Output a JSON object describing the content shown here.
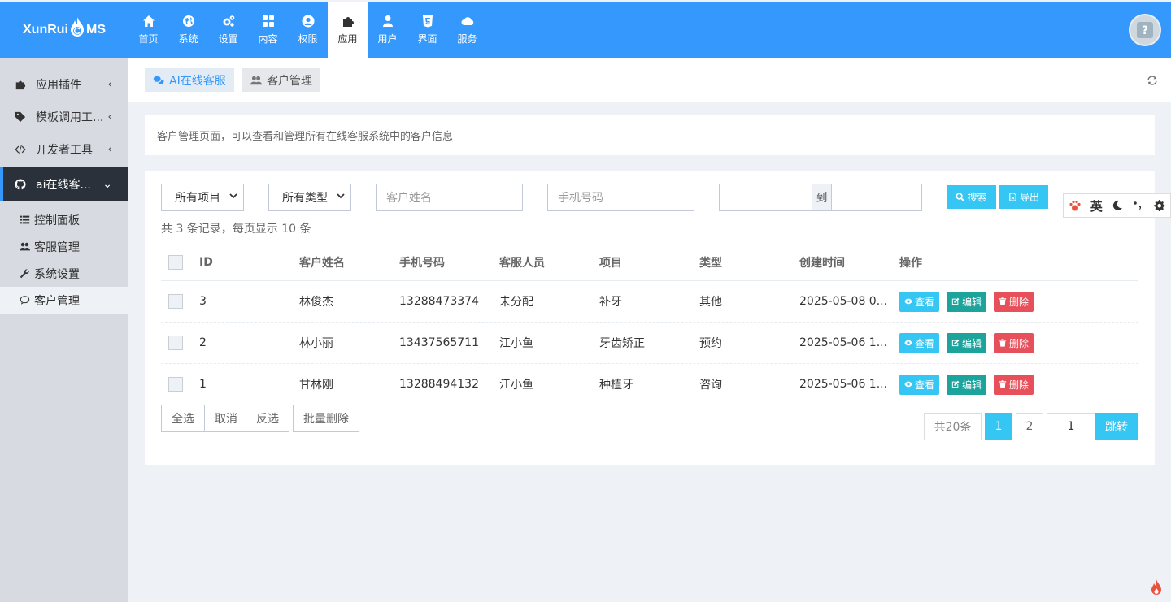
{
  "brand": {
    "left": "XunRui",
    "right": "MS"
  },
  "nav": [
    {
      "label": "首页",
      "icon": "home-icon"
    },
    {
      "label": "系统",
      "icon": "globe-icon"
    },
    {
      "label": "设置",
      "icon": "gears-icon"
    },
    {
      "label": "内容",
      "icon": "grid-icon"
    },
    {
      "label": "权限",
      "icon": "user-circle-icon"
    },
    {
      "label": "应用",
      "icon": "puzzle-icon",
      "active": true
    },
    {
      "label": "用户",
      "icon": "user-icon"
    },
    {
      "label": "界面",
      "icon": "html5-icon"
    },
    {
      "label": "服务",
      "icon": "cloud-icon"
    }
  ],
  "sidebar": {
    "groups": [
      {
        "label": "应用插件",
        "icon": "puzzle-icon"
      },
      {
        "label": "模板调用工...",
        "icon": "tag-icon"
      },
      {
        "label": "开发者工具",
        "icon": "code-icon"
      },
      {
        "label": "ai在线客...",
        "icon": "github-icon",
        "open": true
      }
    ],
    "items": [
      {
        "label": "控制面板",
        "icon": "list-icon"
      },
      {
        "label": "客服管理",
        "icon": "users-icon"
      },
      {
        "label": "系统设置",
        "icon": "wrench-icon"
      },
      {
        "label": "客户管理",
        "icon": "comment-icon",
        "active": true
      }
    ]
  },
  "tabs": [
    {
      "label": "AI在线客服",
      "icon": "comments-icon",
      "active": true
    },
    {
      "label": "客户管理",
      "icon": "users-icon"
    }
  ],
  "note": "客户管理页面，可以查看和管理所有在线客服系统中的客户信息",
  "filters": {
    "project": "所有项目",
    "type": "所有类型",
    "name_placeholder": "客户姓名",
    "phone_placeholder": "手机号码",
    "to": "到",
    "search": "搜索",
    "export": "导出"
  },
  "count_text": "共 3 条记录，每页显示 10 条",
  "table": {
    "headers": [
      "ID",
      "客户姓名",
      "手机号码",
      "客服人员",
      "项目",
      "类型",
      "创建时间",
      "操作"
    ],
    "rows": [
      [
        "3",
        "林俊杰",
        "13288473374",
        "未分配",
        "补牙",
        "其他",
        "2025-05-08 0..."
      ],
      [
        "2",
        "林小丽",
        "13437565711",
        "江小鱼",
        "牙齿矫正",
        "预约",
        "2025-05-06 1..."
      ],
      [
        "1",
        "甘林刚",
        "13288494132",
        "江小鱼",
        "种植牙",
        "咨询",
        "2025-05-06 1..."
      ]
    ],
    "actions": {
      "view": "查看",
      "edit": "编辑",
      "delete": "删除"
    }
  },
  "bulk": {
    "select_all": "全选",
    "cancel": "取消",
    "invert": "反选",
    "batch_delete": "批量删除"
  },
  "pager": {
    "total": "共20条",
    "page1": "1",
    "page2": "2",
    "jump_value": "1",
    "jump": "跳转"
  },
  "widget": {
    "lang": "英"
  },
  "colors": {
    "primary": "#3598fc",
    "info": "#36c6f3",
    "success": "#1ba39c",
    "danger": "#e7505a",
    "sidebar_dark": "#2a313a"
  }
}
